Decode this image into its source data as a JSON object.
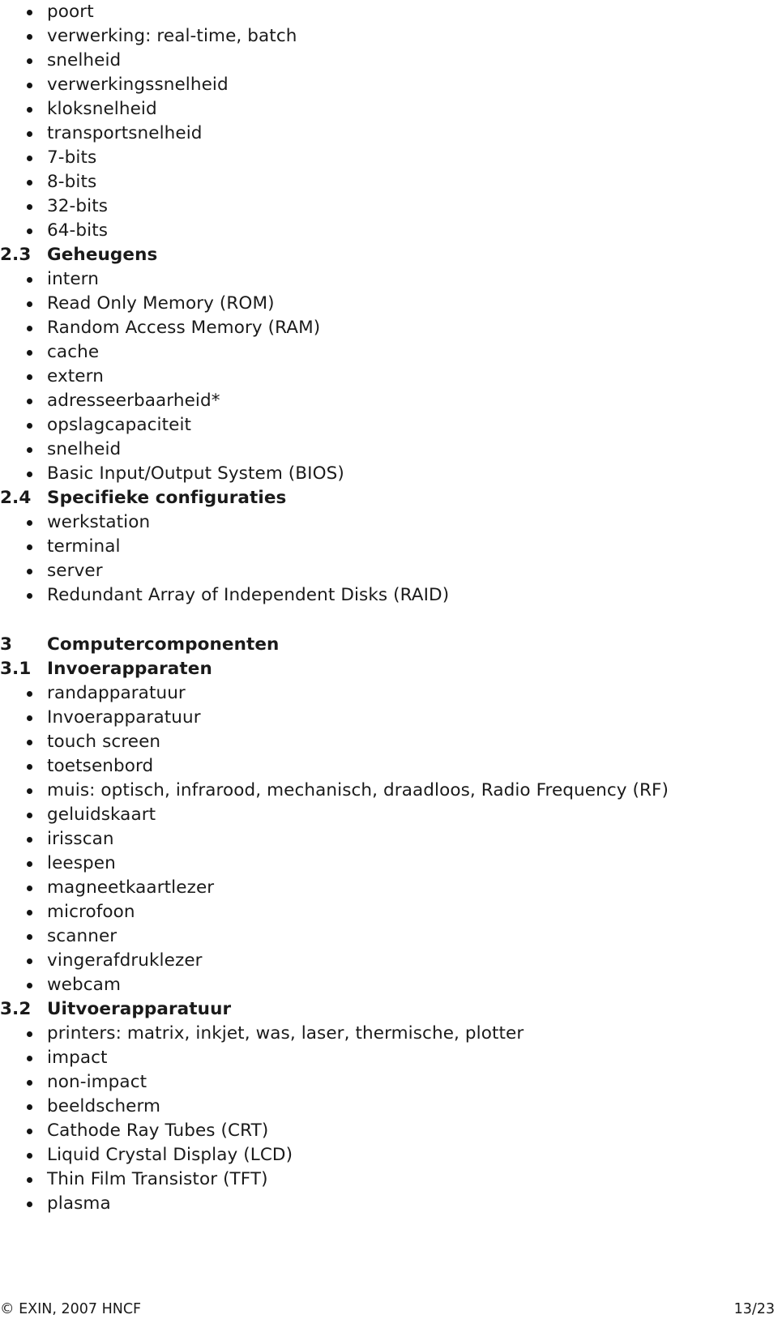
{
  "document": {
    "language": "nl",
    "page_label": "13/23",
    "copyright": "© EXIN, 2007 HNCF"
  },
  "blocks": [
    {
      "kind": "bullet",
      "text": "poort"
    },
    {
      "kind": "bullet",
      "text": "verwerking: real-time, batch"
    },
    {
      "kind": "bullet",
      "text": "snelheid"
    },
    {
      "kind": "bullet",
      "text": "verwerkingssnelheid"
    },
    {
      "kind": "bullet",
      "text": "kloksnelheid"
    },
    {
      "kind": "bullet",
      "text": "transportsnelheid"
    },
    {
      "kind": "bullet",
      "text": "7-bits"
    },
    {
      "kind": "bullet",
      "text": "8-bits"
    },
    {
      "kind": "bullet",
      "text": "32-bits"
    },
    {
      "kind": "bullet",
      "text": "64-bits"
    },
    {
      "kind": "heading",
      "number": "2.3",
      "text": "Geheugens"
    },
    {
      "kind": "bullet",
      "text": "intern"
    },
    {
      "kind": "bullet",
      "text": "Read Only Memory (ROM)"
    },
    {
      "kind": "bullet",
      "text": "Random Access Memory (RAM)"
    },
    {
      "kind": "bullet",
      "text": "cache"
    },
    {
      "kind": "bullet",
      "text": "extern"
    },
    {
      "kind": "bullet",
      "text": "adresseerbaarheid*"
    },
    {
      "kind": "bullet",
      "text": "opslagcapaciteit"
    },
    {
      "kind": "bullet",
      "text": "snelheid"
    },
    {
      "kind": "bullet",
      "text": "Basic Input/Output System (BIOS)"
    },
    {
      "kind": "heading",
      "number": "2.4",
      "text": "Specifieke configuraties"
    },
    {
      "kind": "bullet",
      "text": "werkstation"
    },
    {
      "kind": "bullet",
      "text": "terminal"
    },
    {
      "kind": "bullet",
      "text": "server"
    },
    {
      "kind": "bullet",
      "text": "Redundant Array of Independent Disks (RAID)"
    },
    {
      "kind": "spacer"
    },
    {
      "kind": "heading",
      "number": "3",
      "text": "Computercomponenten"
    },
    {
      "kind": "heading",
      "number": "3.1",
      "text": "Invoerapparaten"
    },
    {
      "kind": "bullet",
      "text": "randapparatuur"
    },
    {
      "kind": "bullet",
      "text": "Invoerapparatuur"
    },
    {
      "kind": "bullet",
      "text": "touch screen"
    },
    {
      "kind": "bullet",
      "text": "toetsenbord"
    },
    {
      "kind": "bullet",
      "text": "muis: optisch, infrarood, mechanisch, draadloos, Radio Frequency (RF)"
    },
    {
      "kind": "bullet",
      "text": "geluidskaart"
    },
    {
      "kind": "bullet",
      "text": "irisscan"
    },
    {
      "kind": "bullet",
      "text": "leespen"
    },
    {
      "kind": "bullet",
      "text": "magneetkaartlezer"
    },
    {
      "kind": "bullet",
      "text": "microfoon"
    },
    {
      "kind": "bullet",
      "text": "scanner"
    },
    {
      "kind": "bullet",
      "text": "vingerafdruklezer"
    },
    {
      "kind": "bullet",
      "text": "webcam"
    },
    {
      "kind": "heading",
      "number": "3.2",
      "text": "Uitvoerapparatuur"
    },
    {
      "kind": "bullet",
      "text": "printers: matrix, inkjet, was, laser, thermische, plotter"
    },
    {
      "kind": "bullet",
      "text": "impact"
    },
    {
      "kind": "bullet",
      "text": "non-impact"
    },
    {
      "kind": "bullet",
      "text": "beeldscherm"
    },
    {
      "kind": "bullet",
      "text": "Cathode Ray Tubes (CRT)"
    },
    {
      "kind": "bullet",
      "text": "Liquid Crystal Display (LCD)"
    },
    {
      "kind": "bullet",
      "text": "Thin Film Transistor (TFT)"
    },
    {
      "kind": "bullet",
      "text": "plasma"
    }
  ]
}
